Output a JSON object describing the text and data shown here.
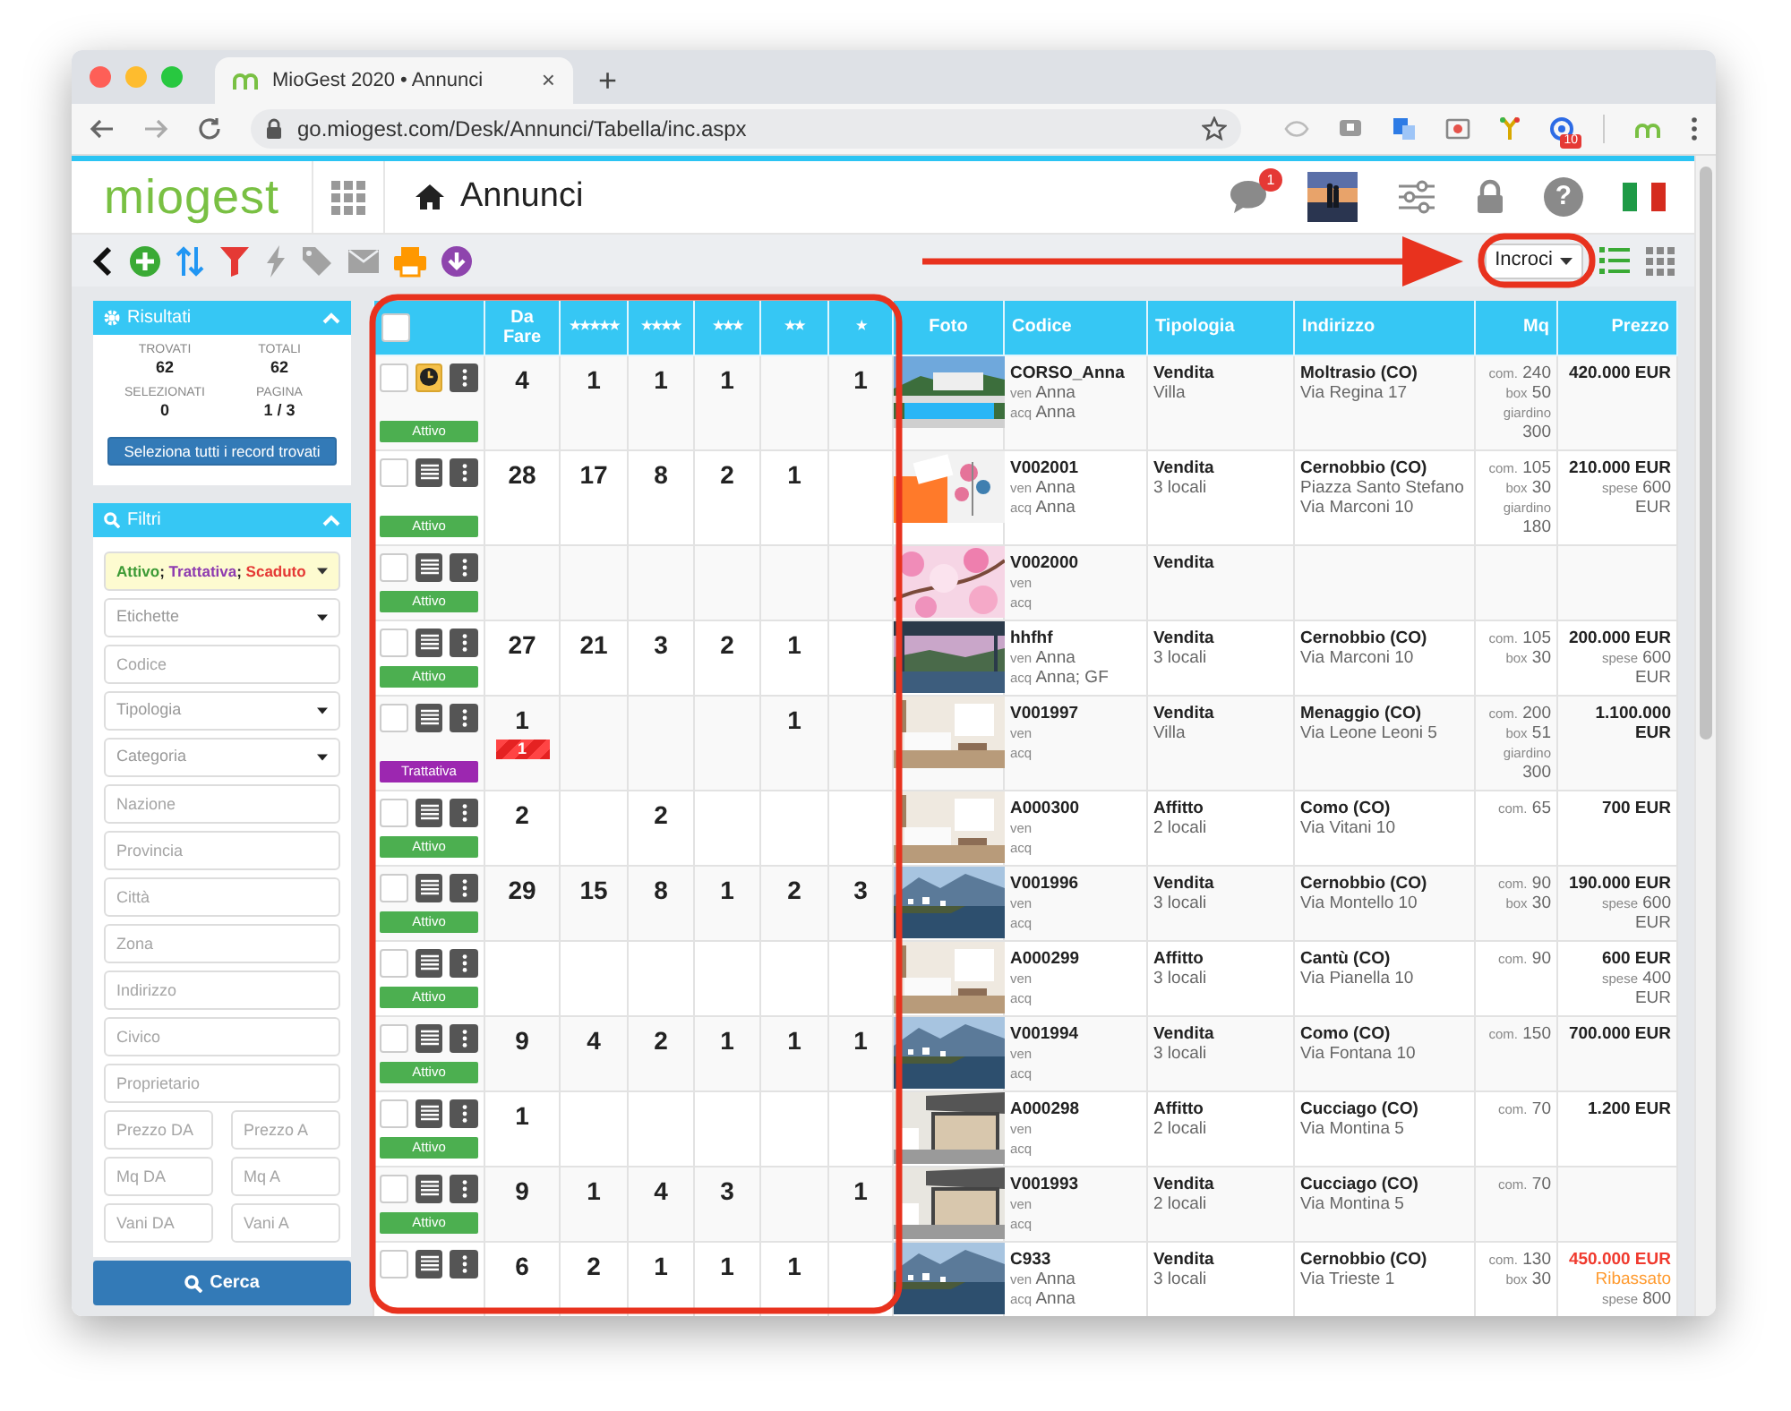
{
  "browser": {
    "tab_title": "MioGest 2020 • Annunci",
    "tab_close": "×",
    "new_tab": "+",
    "url": "go.miogest.com/Desk/Annunci/Tabella/inc.aspx",
    "extension_badge": "10"
  },
  "app": {
    "logo": "miogest",
    "page_title": "Annunci",
    "notifications": "1",
    "help_label": "?"
  },
  "toolbar": {
    "view_dropdown": "Incroci",
    "views": [
      {
        "kind": "list",
        "selected": true
      },
      {
        "kind": "grid",
        "selected": false
      }
    ]
  },
  "results": {
    "title": "Risultati",
    "expanded": true,
    "stats": [
      {
        "label": "TROVATI",
        "value": "62"
      },
      {
        "label": "TOTALI",
        "value": "62"
      },
      {
        "label": "SELEZIONATI",
        "value": "0"
      },
      {
        "label": "PAGINA",
        "value": "1 / 3"
      }
    ],
    "select_all_button": "Seleziona tutti i record trovati"
  },
  "filters": {
    "title": "Filtri",
    "expanded": true,
    "separator": "; ",
    "status_filter": [
      {
        "label": "Attivo",
        "color": "#3c9a35"
      },
      {
        "label": "Trattativa",
        "color": "#8e3bb0"
      },
      {
        "label": "Scaduto",
        "color": "#e53935"
      }
    ],
    "fields": [
      {
        "kind": "select",
        "placeholder": "Etichette"
      },
      {
        "kind": "input",
        "placeholder": "Codice"
      },
      {
        "kind": "select",
        "placeholder": "Tipologia"
      },
      {
        "kind": "select",
        "placeholder": "Categoria"
      },
      {
        "kind": "input",
        "placeholder": "Nazione"
      },
      {
        "kind": "input",
        "placeholder": "Provincia"
      },
      {
        "kind": "input",
        "placeholder": "Città"
      },
      {
        "kind": "input",
        "placeholder": "Zona"
      },
      {
        "kind": "input",
        "placeholder": "Indirizzo"
      },
      {
        "kind": "input",
        "placeholder": "Civico"
      },
      {
        "kind": "input",
        "placeholder": "Proprietario"
      }
    ],
    "ranges": [
      {
        "fields": [
          {
            "placeholder": "Prezzo DA"
          },
          {
            "placeholder": "Prezzo A"
          }
        ]
      },
      {
        "fields": [
          {
            "placeholder": "Mq DA"
          },
          {
            "placeholder": "Mq A"
          }
        ]
      },
      {
        "fields": [
          {
            "placeholder": "Vani DA"
          },
          {
            "placeholder": "Vani A"
          }
        ]
      }
    ],
    "search_button": "Cerca"
  },
  "table": {
    "select_all": {
      "checked": false
    },
    "columns": [
      {
        "label": "Da Fare"
      },
      {
        "label": "★★★★★"
      },
      {
        "label": "★★★★"
      },
      {
        "label": "★★★"
      },
      {
        "label": "★★"
      },
      {
        "label": "★"
      },
      {
        "label": "Foto"
      },
      {
        "label": "Codice"
      },
      {
        "label": "Tipologia"
      },
      {
        "label": "Indirizzo"
      },
      {
        "label": "Mq"
      },
      {
        "label": "Prezzo"
      }
    ],
    "rows": [
      {
        "checked": false,
        "task_button": {
          "kind": "clock"
        },
        "status": {
          "label": "Attivo",
          "kind": "active"
        },
        "counts": {
          "to_do": "4",
          "five_stars": "1",
          "four_stars": "1",
          "three_stars": "1",
          "one_star": "1"
        },
        "photo": {
          "kind": "picture"
        },
        "code": "CORSO_Anna",
        "seller_label": "ven",
        "seller": "Anna",
        "buyer_label": "acq",
        "buyer": "Anna",
        "contract": "Vendita",
        "property_type": "Villa",
        "city": "Moltrasio (CO)",
        "address_lines": [
          "Via Regina 17"
        ],
        "mq": [
          {
            "label": "com.",
            "value": "240"
          },
          {
            "label": "box",
            "value": "50"
          },
          {
            "label": "giardino",
            "value": "300"
          }
        ],
        "price": "420.000 EUR",
        "price_reduced": false
      },
      {
        "checked": false,
        "task_button": {
          "kind": "list"
        },
        "status": {
          "label": "Attivo",
          "kind": "active"
        },
        "counts": {
          "to_do": "28",
          "five_stars": "17",
          "four_stars": "8",
          "three_stars": "2",
          "two_stars": "1"
        },
        "photo": {
          "kind": "picture"
        },
        "code": "V002001",
        "seller_label": "ven",
        "seller": "Anna",
        "buyer_label": "acq",
        "buyer": "Anna",
        "contract": "Vendita",
        "property_type": "3 locali",
        "city": "Cernobbio (CO)",
        "address_lines": [
          "Piazza Santo Stefano",
          "Via Marconi 10"
        ],
        "mq": [
          {
            "label": "com.",
            "value": "105"
          },
          {
            "label": "box",
            "value": "30"
          },
          {
            "label": "giardino",
            "value": "180"
          }
        ],
        "price": "210.000 EUR",
        "price_reduced": false,
        "expenses": {
          "label": "spese",
          "value": "600 EUR"
        }
      },
      {
        "checked": false,
        "task_button": {
          "kind": "list"
        },
        "status": {
          "label": "Attivo",
          "kind": "active"
        },
        "counts": {},
        "photo": {
          "kind": "picture"
        },
        "code": "V002000",
        "seller_label": "ven",
        "buyer_label": "acq",
        "contract": "Vendita"
      },
      {
        "checked": false,
        "task_button": {
          "kind": "list"
        },
        "status": {
          "label": "Attivo",
          "kind": "active"
        },
        "counts": {
          "to_do": "27",
          "five_stars": "21",
          "four_stars": "3",
          "three_stars": "2",
          "two_stars": "1"
        },
        "photo": {
          "kind": "picture"
        },
        "code": "hhfhf",
        "seller_label": "ven",
        "seller": "Anna",
        "buyer_label": "acq",
        "buyer": "Anna; GF",
        "contract": "Vendita",
        "property_type": "3 locali",
        "city": "Cernobbio (CO)",
        "address_lines": [
          "Via Marconi 10"
        ],
        "mq": [
          {
            "label": "com.",
            "value": "105"
          },
          {
            "label": "box",
            "value": "30"
          }
        ],
        "price": "200.000 EUR",
        "price_reduced": false,
        "expenses": {
          "label": "spese",
          "value": "600 EUR"
        }
      },
      {
        "checked": false,
        "task_button": {
          "kind": "list"
        },
        "status": {
          "label": "Trattativa",
          "kind": "negotiation"
        },
        "counts": {
          "to_do": "1",
          "two_stars": "1"
        },
        "alert": "1",
        "photo": {
          "kind": "picture"
        },
        "code": "V001997",
        "seller_label": "ven",
        "buyer_label": "acq",
        "contract": "Vendita",
        "property_type": "Villa",
        "city": "Menaggio (CO)",
        "address_lines": [
          "Via Leone Leoni 5"
        ],
        "mq": [
          {
            "label": "com.",
            "value": "200"
          },
          {
            "label": "box",
            "value": "51"
          },
          {
            "label": "giardino",
            "value": "300"
          }
        ],
        "price": "1.100.000 EUR",
        "price_reduced": false
      },
      {
        "checked": false,
        "task_button": {
          "kind": "list"
        },
        "status": {
          "label": "Attivo",
          "kind": "active"
        },
        "counts": {
          "to_do": "2",
          "four_stars": "2"
        },
        "photo": {
          "kind": "picture"
        },
        "code": "A000300",
        "seller_label": "ven",
        "buyer_label": "acq",
        "contract": "Affitto",
        "property_type": "2 locali",
        "city": "Como (CO)",
        "address_lines": [
          "Via Vitani 10"
        ],
        "mq": [
          {
            "label": "com.",
            "value": "65"
          }
        ],
        "price": "700 EUR",
        "price_reduced": false
      },
      {
        "checked": false,
        "task_button": {
          "kind": "list"
        },
        "status": {
          "label": "Attivo",
          "kind": "active"
        },
        "counts": {
          "to_do": "29",
          "five_stars": "15",
          "four_stars": "8",
          "three_stars": "1",
          "two_stars": "2",
          "one_star": "3"
        },
        "photo": {
          "kind": "picture"
        },
        "code": "V001996",
        "seller_label": "ven",
        "buyer_label": "acq",
        "contract": "Vendita",
        "property_type": "3 locali",
        "city": "Cernobbio (CO)",
        "address_lines": [
          "Via Montello 10"
        ],
        "mq": [
          {
            "label": "com.",
            "value": "90"
          },
          {
            "label": "box",
            "value": "30"
          }
        ],
        "price": "190.000 EUR",
        "price_reduced": false,
        "expenses": {
          "label": "spese",
          "value": "600 EUR"
        }
      },
      {
        "checked": false,
        "task_button": {
          "kind": "list"
        },
        "status": {
          "label": "Attivo",
          "kind": "active"
        },
        "counts": {},
        "photo": {
          "kind": "picture"
        },
        "code": "A000299",
        "seller_label": "ven",
        "buyer_label": "acq",
        "contract": "Affitto",
        "property_type": "3 locali",
        "city": "Cantù (CO)",
        "address_lines": [
          "Via Pianella 10"
        ],
        "mq": [
          {
            "label": "com.",
            "value": "90"
          }
        ],
        "price": "600 EUR",
        "price_reduced": false,
        "expenses": {
          "label": "spese",
          "value": "400 EUR"
        }
      },
      {
        "checked": false,
        "task_button": {
          "kind": "list"
        },
        "status": {
          "label": "Attivo",
          "kind": "active"
        },
        "counts": {
          "to_do": "9",
          "five_stars": "4",
          "four_stars": "2",
          "three_stars": "1",
          "two_stars": "1",
          "one_star": "1"
        },
        "photo": {
          "kind": "picture"
        },
        "code": "V001994",
        "seller_label": "ven",
        "buyer_label": "acq",
        "contract": "Vendita",
        "property_type": "3 locali",
        "city": "Como (CO)",
        "address_lines": [
          "Via Fontana 10"
        ],
        "mq": [
          {
            "label": "com.",
            "value": "150"
          }
        ],
        "price": "700.000 EUR",
        "price_reduced": false
      },
      {
        "checked": false,
        "task_button": {
          "kind": "list"
        },
        "status": {
          "label": "Attivo",
          "kind": "active"
        },
        "counts": {
          "to_do": "1"
        },
        "photo": {
          "kind": "picture"
        },
        "code": "A000298",
        "seller_label": "ven",
        "buyer_label": "acq",
        "contract": "Affitto",
        "property_type": "2 locali",
        "city": "Cucciago (CO)",
        "address_lines": [
          "Via Montina 5"
        ],
        "mq": [
          {
            "label": "com.",
            "value": "70"
          }
        ],
        "price": "1.200 EUR",
        "price_reduced": false
      },
      {
        "checked": false,
        "task_button": {
          "kind": "list"
        },
        "status": {
          "label": "Attivo",
          "kind": "active"
        },
        "counts": {
          "to_do": "9",
          "five_stars": "1",
          "four_stars": "4",
          "three_stars": "3",
          "one_star": "1"
        },
        "photo": {
          "kind": "picture"
        },
        "code": "V001993",
        "seller_label": "ven",
        "buyer_label": "acq",
        "contract": "Vendita",
        "property_type": "2 locali",
        "city": "Cucciago (CO)",
        "address_lines": [
          "Via Montina 5"
        ],
        "mq": [
          {
            "label": "com.",
            "value": "70"
          }
        ]
      },
      {
        "checked": false,
        "task_button": {
          "kind": "list"
        },
        "counts": {
          "to_do": "6",
          "five_stars": "2",
          "four_stars": "1",
          "three_stars": "1",
          "two_stars": "1"
        },
        "photo": {
          "kind": "picture"
        },
        "code": "C933",
        "seller_label": "ven",
        "seller": "Anna",
        "buyer_label": "acq",
        "buyer": "Anna",
        "contract": "Vendita",
        "property_type": "3 locali",
        "city": "Cernobbio (CO)",
        "address_lines": [
          "Via Trieste 1"
        ],
        "mq": [
          {
            "label": "com.",
            "value": "130"
          },
          {
            "label": "box",
            "value": "30"
          }
        ],
        "price": "450.000 EUR",
        "price_reduced": true,
        "price_note": "Ribassato",
        "expenses": {
          "label": "spese",
          "value": "800"
        }
      }
    ]
  }
}
